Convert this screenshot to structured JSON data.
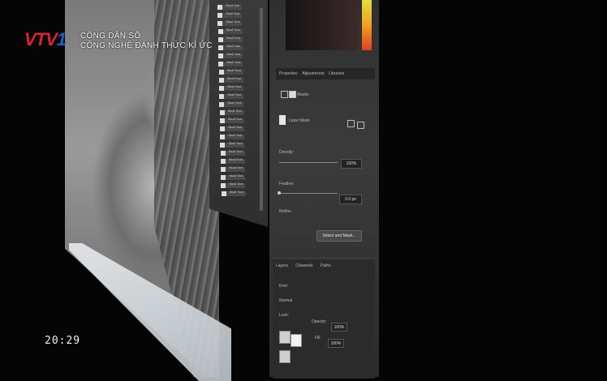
{
  "broadcast": {
    "channel_logo": {
      "text_red": "VTV",
      "text_blue": "1",
      "colors": {
        "red": "#d8232a",
        "blue": "#1f5fc4"
      }
    },
    "program_title": "CÔNG DÂN SỐ",
    "segment_title": "CÔNG NGHỆ ĐÁNH THỨC KÍ ỨC",
    "clock": "20:29"
  },
  "photoshop_panel": {
    "tabs": [
      "Properties",
      "Adjustments",
      "Libraries"
    ],
    "masks_label": "Masks",
    "layer_mask_label": "Layer Mask",
    "density_label": "Density:",
    "density_value": "100%",
    "feather_label": "Feather:",
    "feather_value": "0.0 px",
    "refine_label": "Refine:",
    "select_mask_button": "Select and Mask...",
    "lower_tabs": [
      "Layers",
      "Channels",
      "Paths"
    ],
    "kind_label": "Kind",
    "normal_label": "Normal",
    "opacity_label": "Opacity:",
    "opacity_value": "100%",
    "lock_label": "Lock:",
    "fill_label": "Fill:",
    "fill_value": "100%",
    "layer_names": [
      "Skull Tool",
      "Skull Tool",
      "Skull Tool",
      "Skull Tool",
      "Skull Tool",
      "Skull Tool",
      "Skull Tool",
      "Skull Tool",
      "Skull Tool",
      "Skull Tool",
      "Skull Tool",
      "Skull Tool",
      "Skull Tool",
      "Skull Tool",
      "Skull Tool",
      "Skull Tool",
      "Skull Tool",
      "Skull Tool",
      "Skull Tool",
      "Skull Tool",
      "Skull Tool",
      "Skull Tool",
      "Skull Tool",
      "Skull Tool"
    ]
  }
}
